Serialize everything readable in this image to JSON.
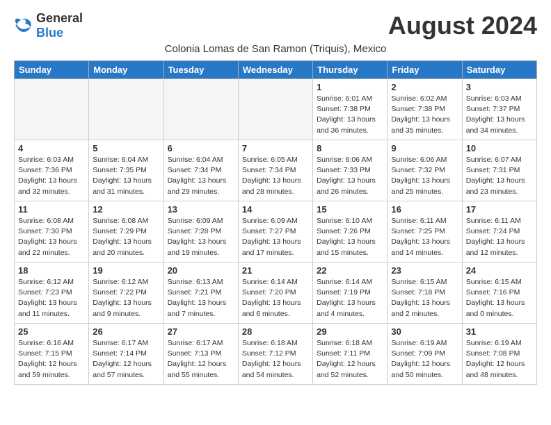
{
  "header": {
    "logo_general": "General",
    "logo_blue": "Blue",
    "month_title": "August 2024",
    "subtitle": "Colonia Lomas de San Ramon (Triquis), Mexico"
  },
  "weekdays": [
    "Sunday",
    "Monday",
    "Tuesday",
    "Wednesday",
    "Thursday",
    "Friday",
    "Saturday"
  ],
  "weeks": [
    [
      {
        "day": "",
        "info": ""
      },
      {
        "day": "",
        "info": ""
      },
      {
        "day": "",
        "info": ""
      },
      {
        "day": "",
        "info": ""
      },
      {
        "day": "1",
        "sunrise": "6:01 AM",
        "sunset": "7:38 PM",
        "daylight": "13 hours and 36 minutes."
      },
      {
        "day": "2",
        "sunrise": "6:02 AM",
        "sunset": "7:38 PM",
        "daylight": "13 hours and 35 minutes."
      },
      {
        "day": "3",
        "sunrise": "6:03 AM",
        "sunset": "7:37 PM",
        "daylight": "13 hours and 34 minutes."
      }
    ],
    [
      {
        "day": "4",
        "sunrise": "6:03 AM",
        "sunset": "7:36 PM",
        "daylight": "13 hours and 32 minutes."
      },
      {
        "day": "5",
        "sunrise": "6:04 AM",
        "sunset": "7:35 PM",
        "daylight": "13 hours and 31 minutes."
      },
      {
        "day": "6",
        "sunrise": "6:04 AM",
        "sunset": "7:34 PM",
        "daylight": "13 hours and 29 minutes."
      },
      {
        "day": "7",
        "sunrise": "6:05 AM",
        "sunset": "7:34 PM",
        "daylight": "13 hours and 28 minutes."
      },
      {
        "day": "8",
        "sunrise": "6:06 AM",
        "sunset": "7:33 PM",
        "daylight": "13 hours and 26 minutes."
      },
      {
        "day": "9",
        "sunrise": "6:06 AM",
        "sunset": "7:32 PM",
        "daylight": "13 hours and 25 minutes."
      },
      {
        "day": "10",
        "sunrise": "6:07 AM",
        "sunset": "7:31 PM",
        "daylight": "13 hours and 23 minutes."
      }
    ],
    [
      {
        "day": "11",
        "sunrise": "6:08 AM",
        "sunset": "7:30 PM",
        "daylight": "13 hours and 22 minutes."
      },
      {
        "day": "12",
        "sunrise": "6:08 AM",
        "sunset": "7:29 PM",
        "daylight": "13 hours and 20 minutes."
      },
      {
        "day": "13",
        "sunrise": "6:09 AM",
        "sunset": "7:28 PM",
        "daylight": "13 hours and 19 minutes."
      },
      {
        "day": "14",
        "sunrise": "6:09 AM",
        "sunset": "7:27 PM",
        "daylight": "13 hours and 17 minutes."
      },
      {
        "day": "15",
        "sunrise": "6:10 AM",
        "sunset": "7:26 PM",
        "daylight": "13 hours and 15 minutes."
      },
      {
        "day": "16",
        "sunrise": "6:11 AM",
        "sunset": "7:25 PM",
        "daylight": "13 hours and 14 minutes."
      },
      {
        "day": "17",
        "sunrise": "6:11 AM",
        "sunset": "7:24 PM",
        "daylight": "13 hours and 12 minutes."
      }
    ],
    [
      {
        "day": "18",
        "sunrise": "6:12 AM",
        "sunset": "7:23 PM",
        "daylight": "13 hours and 11 minutes."
      },
      {
        "day": "19",
        "sunrise": "6:12 AM",
        "sunset": "7:22 PM",
        "daylight": "13 hours and 9 minutes."
      },
      {
        "day": "20",
        "sunrise": "6:13 AM",
        "sunset": "7:21 PM",
        "daylight": "13 hours and 7 minutes."
      },
      {
        "day": "21",
        "sunrise": "6:14 AM",
        "sunset": "7:20 PM",
        "daylight": "13 hours and 6 minutes."
      },
      {
        "day": "22",
        "sunrise": "6:14 AM",
        "sunset": "7:19 PM",
        "daylight": "13 hours and 4 minutes."
      },
      {
        "day": "23",
        "sunrise": "6:15 AM",
        "sunset": "7:18 PM",
        "daylight": "13 hours and 2 minutes."
      },
      {
        "day": "24",
        "sunrise": "6:15 AM",
        "sunset": "7:16 PM",
        "daylight": "13 hours and 0 minutes."
      }
    ],
    [
      {
        "day": "25",
        "sunrise": "6:16 AM",
        "sunset": "7:15 PM",
        "daylight": "12 hours and 59 minutes."
      },
      {
        "day": "26",
        "sunrise": "6:17 AM",
        "sunset": "7:14 PM",
        "daylight": "12 hours and 57 minutes."
      },
      {
        "day": "27",
        "sunrise": "6:17 AM",
        "sunset": "7:13 PM",
        "daylight": "12 hours and 55 minutes."
      },
      {
        "day": "28",
        "sunrise": "6:18 AM",
        "sunset": "7:12 PM",
        "daylight": "12 hours and 54 minutes."
      },
      {
        "day": "29",
        "sunrise": "6:18 AM",
        "sunset": "7:11 PM",
        "daylight": "12 hours and 52 minutes."
      },
      {
        "day": "30",
        "sunrise": "6:19 AM",
        "sunset": "7:09 PM",
        "daylight": "12 hours and 50 minutes."
      },
      {
        "day": "31",
        "sunrise": "6:19 AM",
        "sunset": "7:08 PM",
        "daylight": "12 hours and 48 minutes."
      }
    ]
  ],
  "labels": {
    "sunrise": "Sunrise:",
    "sunset": "Sunset:",
    "daylight": "Daylight:"
  }
}
